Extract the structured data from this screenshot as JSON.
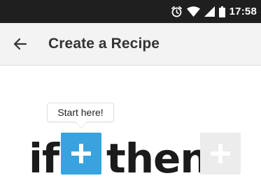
{
  "status_bar": {
    "time": "17:58",
    "icons": [
      "alarm-icon",
      "wifi-icon",
      "signal-icon",
      "battery-icon"
    ]
  },
  "toolbar": {
    "back_icon": "arrow-left-icon",
    "title": "Create a Recipe"
  },
  "builder": {
    "tooltip": "Start here!",
    "if_word": "if",
    "then_word": "then",
    "if_button_icon": "plus-icon",
    "then_button_icon": "plus-icon"
  },
  "colors": {
    "status_bar_bg": "#1f1f1f",
    "toolbar_bg": "#f3f3f3",
    "if_plus_bg": "#38a3de",
    "then_plus_bg": "#ececec"
  }
}
